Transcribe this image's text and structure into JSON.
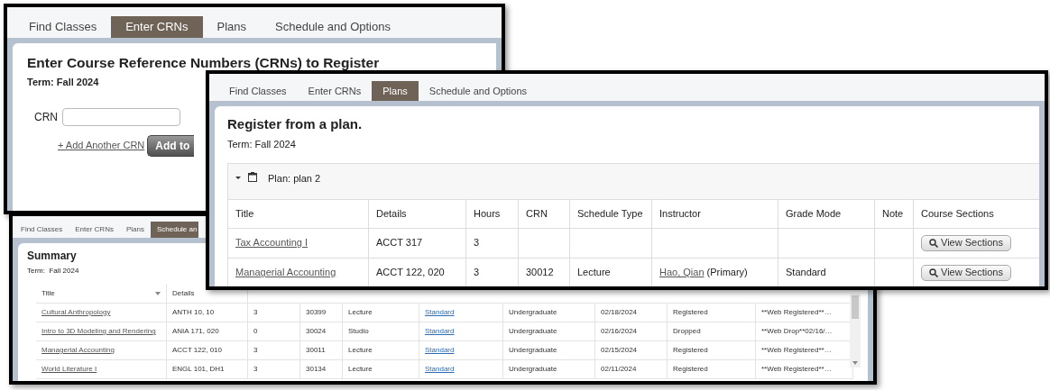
{
  "windows": [
    {
      "kind": "crn_entry",
      "tabs": [
        {
          "label": "Find Classes",
          "selected": false
        },
        {
          "label": "Enter CRNs",
          "selected": true
        },
        {
          "label": "Plans",
          "selected": false
        },
        {
          "label": "Schedule and Options",
          "selected": false
        }
      ],
      "heading": "Enter Course Reference Numbers (CRNs) to Register",
      "term": "Term: Fall 2024",
      "crn_label": "CRN",
      "add_link": "+ Add Another CRN",
      "add_button": "Add to"
    },
    {
      "kind": "summary",
      "tabs": [
        {
          "label": "Find Classes",
          "selected": false
        },
        {
          "label": "Enter CRNs",
          "selected": false
        },
        {
          "label": "Plans",
          "selected": false
        },
        {
          "label": "Schedule an",
          "selected": true
        }
      ],
      "heading": "Summary",
      "term": "Term:  Fall 2024",
      "table": {
        "columns": [
          "Title",
          "Details"
        ],
        "rows": [
          {
            "title": "Cultural Anthropology",
            "details": "ANTH 10, 10",
            "hours": "3",
            "crn": "30399",
            "schedule_type": "Lecture",
            "grade_mode": "Standard",
            "level": "Undergraduate",
            "date": "02/18/2024",
            "status": "Registered",
            "note": "**Web Registered**…"
          },
          {
            "title": "Intro to 3D Modeling and Rendering",
            "details": "ANIA 171, 020",
            "hours": "0",
            "crn": "30024",
            "schedule_type": "Studio",
            "grade_mode": "Standard",
            "level": "Undergraduate",
            "date": "02/16/2024",
            "status": "Dropped",
            "note": "**Web Drop**02/16/…"
          },
          {
            "title": "Managerial Accounting",
            "details": "ACCT 122, 010",
            "hours": "3",
            "crn": "30011",
            "schedule_type": "Lecture",
            "grade_mode": "Standard",
            "level": "Undergraduate",
            "date": "02/15/2024",
            "status": "Registered",
            "note": "**Web Registered**…"
          },
          {
            "title": "World Literature I",
            "details": "ENGL 101, DH1",
            "hours": "3",
            "crn": "30134",
            "schedule_type": "Lecture",
            "grade_mode": "Standard",
            "level": "Undergraduate",
            "date": "02/11/2024",
            "status": "Registered",
            "note": "**Web Registered**…"
          }
        ]
      }
    },
    {
      "kind": "plan",
      "tabs": [
        {
          "label": "Find Classes",
          "selected": false
        },
        {
          "label": "Enter CRNs",
          "selected": false
        },
        {
          "label": "Plans",
          "selected": true
        },
        {
          "label": "Schedule and Options",
          "selected": false
        }
      ],
      "heading": "Register from a plan.",
      "term": "Term: Fall 2024",
      "plan": {
        "label": "Plan: plan 2",
        "expanded": true
      },
      "table": {
        "columns": [
          "Title",
          "Details",
          "Hours",
          "CRN",
          "Schedule Type",
          "Instructor",
          "Grade Mode",
          "Note",
          "Course Sections"
        ],
        "rows": [
          {
            "title": "Tax Accounting I",
            "details": "ACCT 317",
            "hours": "3",
            "button": "View Sections"
          },
          {
            "title": "Managerial Accounting",
            "details": "ACCT 122, 020",
            "hours": "3",
            "crn": "30012",
            "schedule_type": "Lecture",
            "instructor": "Hao, Qian",
            "instructor_role": "(Primary)",
            "grade_mode": "Standard",
            "button": "View Sections"
          }
        ]
      }
    }
  ]
}
